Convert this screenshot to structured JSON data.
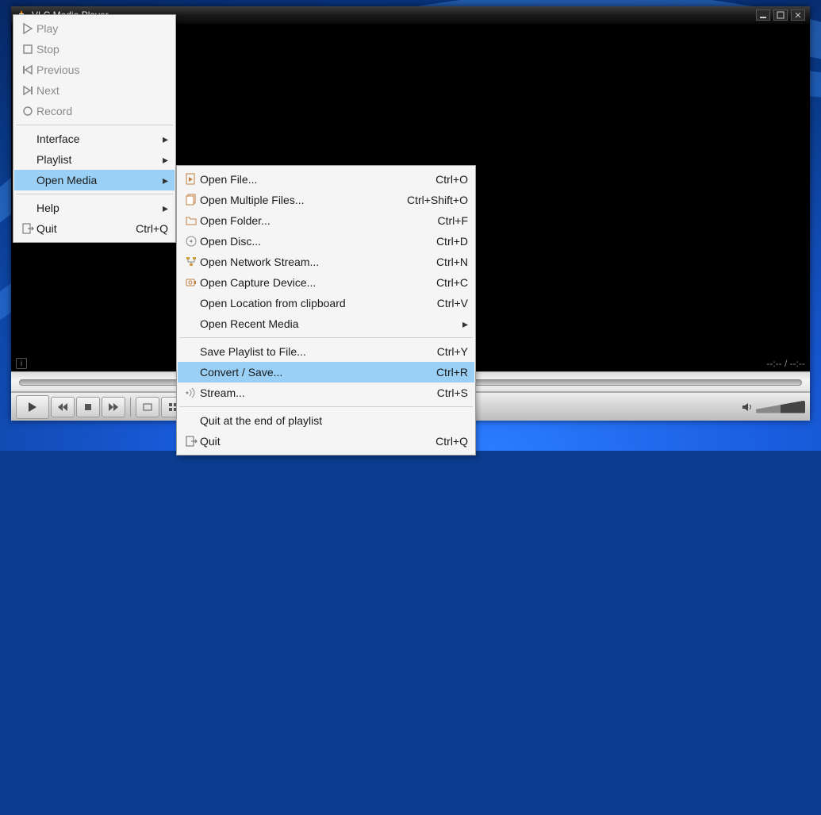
{
  "titlebar": {
    "title": "VLC Media Player"
  },
  "status": {
    "time": "--:--",
    "total": "--:--"
  },
  "menu1": {
    "items": [
      {
        "kind": "item",
        "icon": "play-outline-icon",
        "label": "Play",
        "disabled": true
      },
      {
        "kind": "item",
        "icon": "stop-outline-icon",
        "label": "Stop",
        "disabled": true
      },
      {
        "kind": "item",
        "icon": "prev-outline-icon",
        "label": "Previous",
        "disabled": true
      },
      {
        "kind": "item",
        "icon": "next-outline-icon",
        "label": "Next",
        "disabled": true
      },
      {
        "kind": "item",
        "icon": "record-outline-icon",
        "label": "Record",
        "disabled": true
      },
      {
        "kind": "sep"
      },
      {
        "kind": "submenu",
        "label": "Interface"
      },
      {
        "kind": "submenu",
        "label": "Playlist"
      },
      {
        "kind": "submenu",
        "label": "Open Media",
        "highlight": true
      },
      {
        "kind": "sep"
      },
      {
        "kind": "submenu",
        "label": "Help"
      },
      {
        "kind": "item",
        "icon": "quit-icon",
        "label": "Quit",
        "accel": "Ctrl+Q"
      }
    ]
  },
  "menu2": {
    "items": [
      {
        "kind": "item",
        "icon": "file-play-icon",
        "label": "Open File...",
        "accel": "Ctrl+O"
      },
      {
        "kind": "item",
        "icon": "files-icon",
        "label": "Open Multiple Files...",
        "accel": "Ctrl+Shift+O"
      },
      {
        "kind": "item",
        "icon": "folder-icon",
        "label": "Open Folder...",
        "accel": "Ctrl+F"
      },
      {
        "kind": "item",
        "icon": "disc-icon",
        "label": "Open Disc...",
        "accel": "Ctrl+D"
      },
      {
        "kind": "item",
        "icon": "network-icon",
        "label": "Open Network Stream...",
        "accel": "Ctrl+N"
      },
      {
        "kind": "item",
        "icon": "capture-icon",
        "label": "Open Capture Device...",
        "accel": "Ctrl+C"
      },
      {
        "kind": "item",
        "icon": "",
        "label": "Open Location from clipboard",
        "accel": "Ctrl+V"
      },
      {
        "kind": "submenu",
        "icon": "",
        "label": "Open Recent Media"
      },
      {
        "kind": "sep"
      },
      {
        "kind": "item",
        "icon": "",
        "label": "Save Playlist to File...",
        "accel": "Ctrl+Y"
      },
      {
        "kind": "item",
        "icon": "",
        "label": "Convert / Save...",
        "accel": "Ctrl+R",
        "highlight": true
      },
      {
        "kind": "item",
        "icon": "stream-icon",
        "label": "Stream...",
        "accel": "Ctrl+S"
      },
      {
        "kind": "sep"
      },
      {
        "kind": "item",
        "icon": "",
        "label": "Quit at the end of playlist"
      },
      {
        "kind": "item",
        "icon": "quit-icon",
        "label": "Quit",
        "accel": "Ctrl+Q"
      }
    ]
  }
}
